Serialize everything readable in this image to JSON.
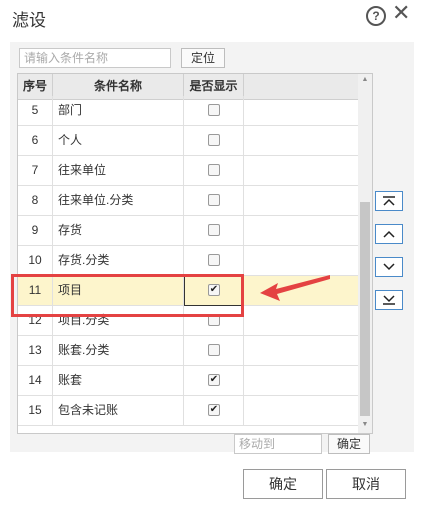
{
  "title": "滤设",
  "help_glyph": "?",
  "close_glyph": "✕",
  "search": {
    "placeholder": "请输入条件名称",
    "locate_label": "定位"
  },
  "columns": {
    "no": "序号",
    "name": "条件名称",
    "show": "是否显示"
  },
  "rows": [
    {
      "no": "5",
      "name": "部门",
      "checked": false
    },
    {
      "no": "6",
      "name": "个人",
      "checked": false
    },
    {
      "no": "7",
      "name": "往来单位",
      "checked": false
    },
    {
      "no": "8",
      "name": "往来单位.分类",
      "checked": false
    },
    {
      "no": "9",
      "name": "存货",
      "checked": false
    },
    {
      "no": "10",
      "name": "存货.分类",
      "checked": false
    },
    {
      "no": "11",
      "name": "项目",
      "checked": true,
      "selected": true
    },
    {
      "no": "12",
      "name": "项目.分类",
      "checked": false
    },
    {
      "no": "13",
      "name": "账套.分类",
      "checked": false
    },
    {
      "no": "14",
      "name": "账套",
      "checked": true
    },
    {
      "no": "15",
      "name": "包含未记账",
      "checked": true
    }
  ],
  "move": {
    "placeholder": "移动到",
    "ok_label": "确定"
  },
  "footer": {
    "ok_label": "确定",
    "cancel_label": "取消"
  },
  "colors": {
    "highlight": "#e44242",
    "selected_row": "#fdf5cc",
    "side_button_border": "#4a8ac9"
  }
}
